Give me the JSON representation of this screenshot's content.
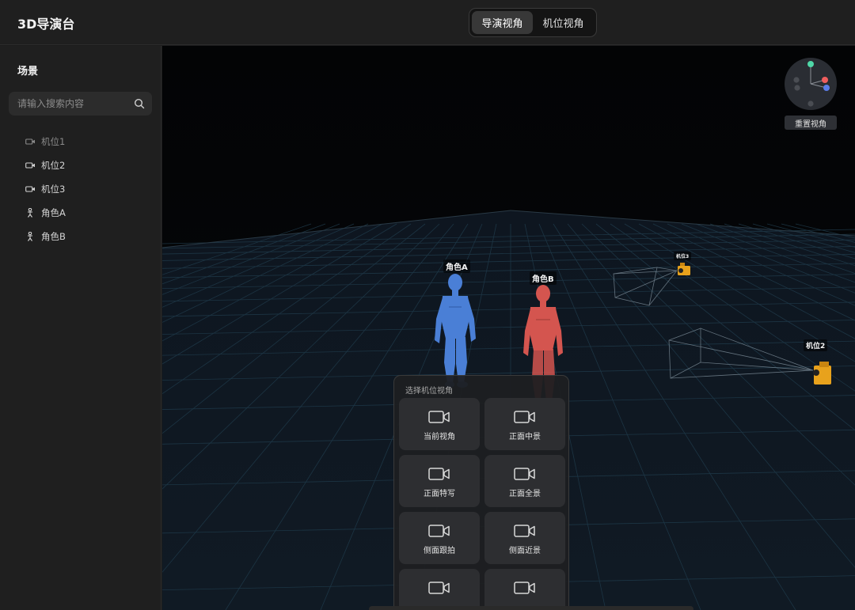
{
  "header": {
    "app_title": "3D导演台",
    "view_tabs": [
      {
        "label": "导演视角",
        "active": true
      },
      {
        "label": "机位视角",
        "active": false
      }
    ]
  },
  "sidebar": {
    "title": "场景",
    "search": {
      "placeholder": "请输入搜索内容",
      "value": ""
    },
    "items": [
      {
        "label": "机位1",
        "icon": "camera-icon",
        "dim": true
      },
      {
        "label": "机位2",
        "icon": "camera-icon",
        "dim": false
      },
      {
        "label": "机位3",
        "icon": "camera-icon",
        "dim": false
      },
      {
        "label": "角色A",
        "icon": "person-icon",
        "dim": false
      },
      {
        "label": "角色B",
        "icon": "person-icon",
        "dim": false
      }
    ]
  },
  "viewport": {
    "reset_view_label": "重置视角",
    "character_labels": {
      "a": "角色A",
      "b": "角色B"
    },
    "camera_labels": {
      "cam3": "机位3",
      "cam2": "机位2"
    },
    "colors": {
      "character_a": "#4a7fd6",
      "character_b": "#d4554f",
      "camera_body": "#e8a21c",
      "grid": "#1f3a4a",
      "gizmo_y": "#4fd8a8",
      "gizmo_x": "#ef5e5e",
      "gizmo_z": "#5b7de8"
    }
  },
  "camera_panel": {
    "title": "选择机位视角",
    "shots": [
      {
        "label": "当前视角",
        "icon": "video-camera-icon"
      },
      {
        "label": "正面中景",
        "icon": "video-camera-icon"
      },
      {
        "label": "正面特写",
        "icon": "video-camera-icon"
      },
      {
        "label": "正面全景",
        "icon": "video-camera-icon"
      },
      {
        "label": "侧面跟拍",
        "icon": "video-camera-icon"
      },
      {
        "label": "侧面近景",
        "icon": "video-camera-icon"
      },
      {
        "label": "",
        "icon": "video-camera-icon"
      },
      {
        "label": "",
        "icon": "video-camera-icon"
      }
    ]
  }
}
